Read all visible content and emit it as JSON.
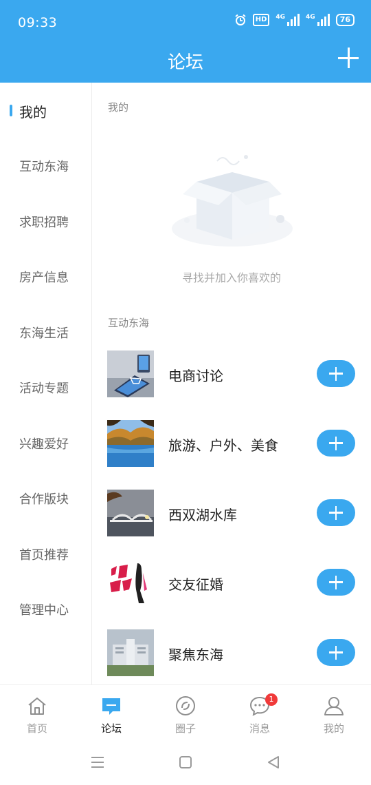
{
  "status_bar": {
    "time": "09:33",
    "hd": "HD",
    "net1": "4G",
    "net2": "4G",
    "battery": "76"
  },
  "header": {
    "title": "论坛"
  },
  "sidebar": {
    "items": [
      {
        "label": "我的",
        "active": true
      },
      {
        "label": "互动东海"
      },
      {
        "label": "求职招聘"
      },
      {
        "label": "房产信息"
      },
      {
        "label": "东海生活"
      },
      {
        "label": "活动专题"
      },
      {
        "label": "兴趣爱好"
      },
      {
        "label": "合作版块"
      },
      {
        "label": "首页推荐"
      },
      {
        "label": "管理中心"
      }
    ]
  },
  "content": {
    "my_section": {
      "title": "我的",
      "empty_text": "寻找并加入你喜欢的"
    },
    "interact_section": {
      "title": "互动东海"
    },
    "forums": [
      {
        "name": "电商讨论",
        "thumb": "ecommerce-photo"
      },
      {
        "name": "旅游、户外、美食",
        "thumb": "lake-photo"
      },
      {
        "name": "西双湖水库",
        "thumb": "bridge-photo"
      },
      {
        "name": "交友征婚",
        "thumb": "dating-photo"
      },
      {
        "name": "聚焦东海",
        "thumb": "building-photo"
      }
    ]
  },
  "tabbar": {
    "tabs": [
      {
        "label": "首页",
        "icon": "home-icon"
      },
      {
        "label": "论坛",
        "icon": "forum-icon",
        "active": true
      },
      {
        "label": "圈子",
        "icon": "circle-icon"
      },
      {
        "label": "消息",
        "icon": "message-icon",
        "badge": "1"
      },
      {
        "label": "我的",
        "icon": "profile-icon"
      }
    ]
  },
  "colors": {
    "primary": "#3aa8ef",
    "badge": "#f03a3a"
  }
}
